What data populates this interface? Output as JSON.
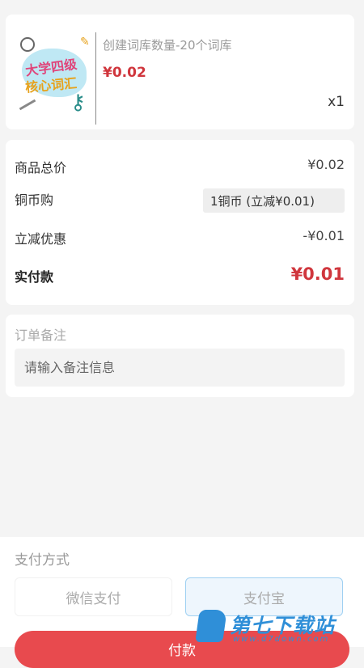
{
  "product": {
    "title": "创建词库数量-20个词库",
    "price": "¥0.02",
    "quantity": "x1",
    "image_words": [
      "大学四级",
      "核心词汇"
    ]
  },
  "summary": {
    "total_label": "商品总价",
    "total_value": "¥0.02",
    "coin_label": "铜币购",
    "coin_value": "1铜币 (立减¥0.01)",
    "discount_label": "立减优惠",
    "discount_value": "-¥0.01",
    "paid_label": "实付款",
    "paid_value": "¥0.01"
  },
  "remarks": {
    "label": "订单备注",
    "placeholder": "请输入备注信息"
  },
  "payment": {
    "title": "支付方式",
    "options": [
      "微信支付",
      "支付宝"
    ],
    "selected": "支付宝",
    "button_label": "付款"
  },
  "watermark": {
    "text": "第七下载站",
    "url": "www.d7down.com"
  },
  "colors": {
    "price_red": "#d0363d",
    "button_red": "#e84a4e",
    "alipay_blue": "#9fd0f2",
    "watermark_blue": "#2f8fd8"
  }
}
